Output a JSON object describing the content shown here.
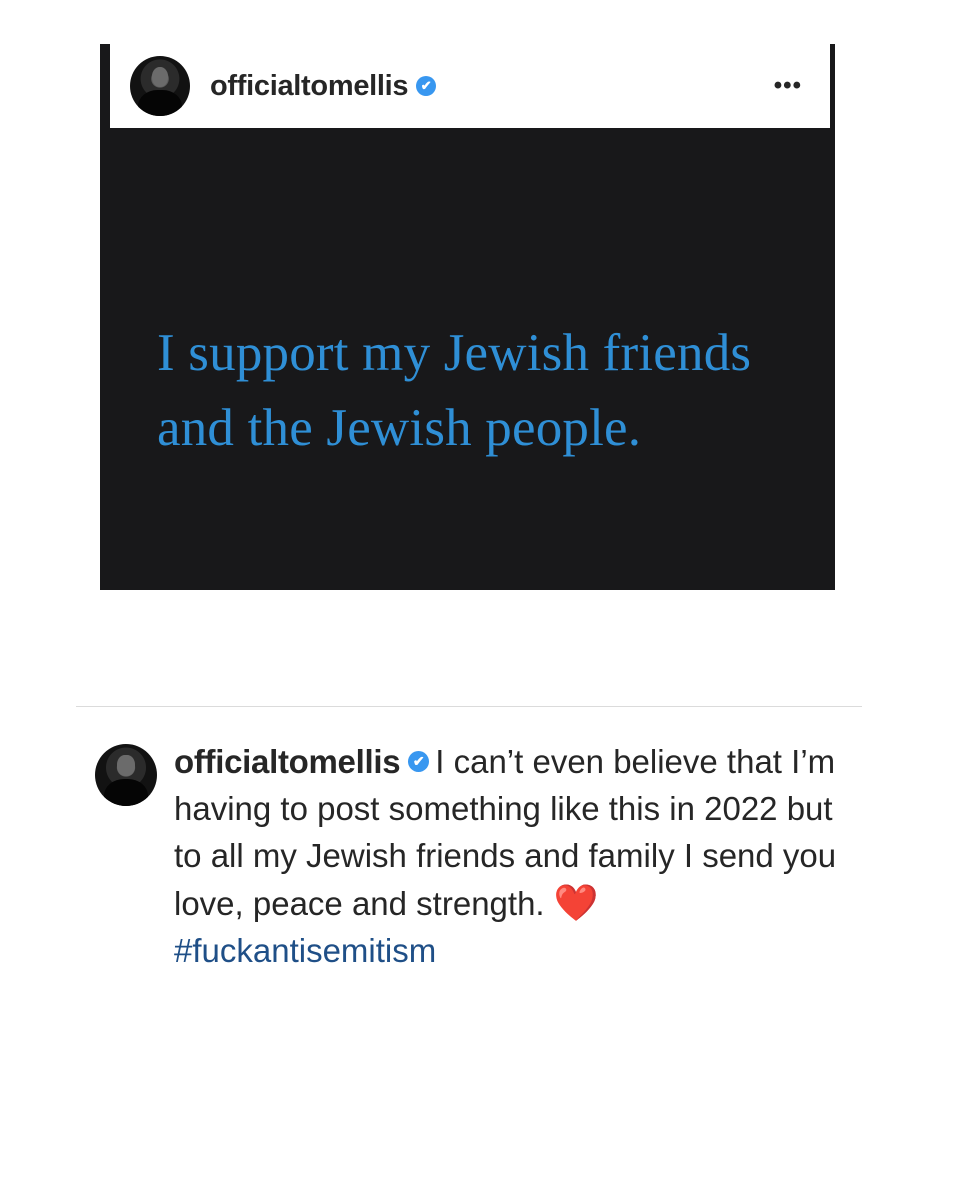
{
  "post": {
    "username": "officialtomellis",
    "verified_icon": "✔",
    "more_icon": "•••",
    "image_text": "I support my Jewish friends and the Jewish people."
  },
  "caption": {
    "username": "officialtomellis",
    "verified_icon": "✔",
    "text": "I can’t even believe that  I’m having to post something like this in 2022 but to all my Jewish friends and family I send you love, peace and strength.",
    "emoji": "❤️",
    "hashtag": "#fuckantisemitism"
  },
  "colors": {
    "image_background": "#18181a",
    "image_text": "#2f8fd6",
    "verified": "#3897f0",
    "hashtag": "#1f4f87"
  }
}
